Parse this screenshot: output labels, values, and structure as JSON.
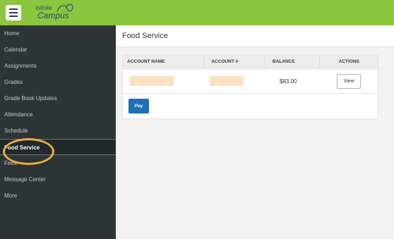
{
  "app": {
    "brand_line1": "Infinite",
    "brand_line2": "Campus",
    "accent_color": "#8cc63f"
  },
  "sidebar": {
    "items": [
      {
        "label": "Home"
      },
      {
        "label": "Calendar"
      },
      {
        "label": "Assignments"
      },
      {
        "label": "Grades"
      },
      {
        "label": "Grade Book Updates"
      },
      {
        "label": "Attendance"
      },
      {
        "label": "Schedule"
      },
      {
        "label": "Food Service",
        "active": true
      },
      {
        "label": "Fees"
      },
      {
        "label": "Message Center"
      },
      {
        "label": "More"
      }
    ]
  },
  "main": {
    "page_title": "Food Service",
    "table": {
      "headers": [
        "ACCOUNT NAME",
        "ACCOUNT #",
        "BALANCE",
        "ACTIONS"
      ],
      "rows": [
        {
          "account_name": "",
          "account_number": "",
          "balance": "$83.00",
          "action": "View"
        }
      ]
    },
    "pay_label": "Pay"
  }
}
